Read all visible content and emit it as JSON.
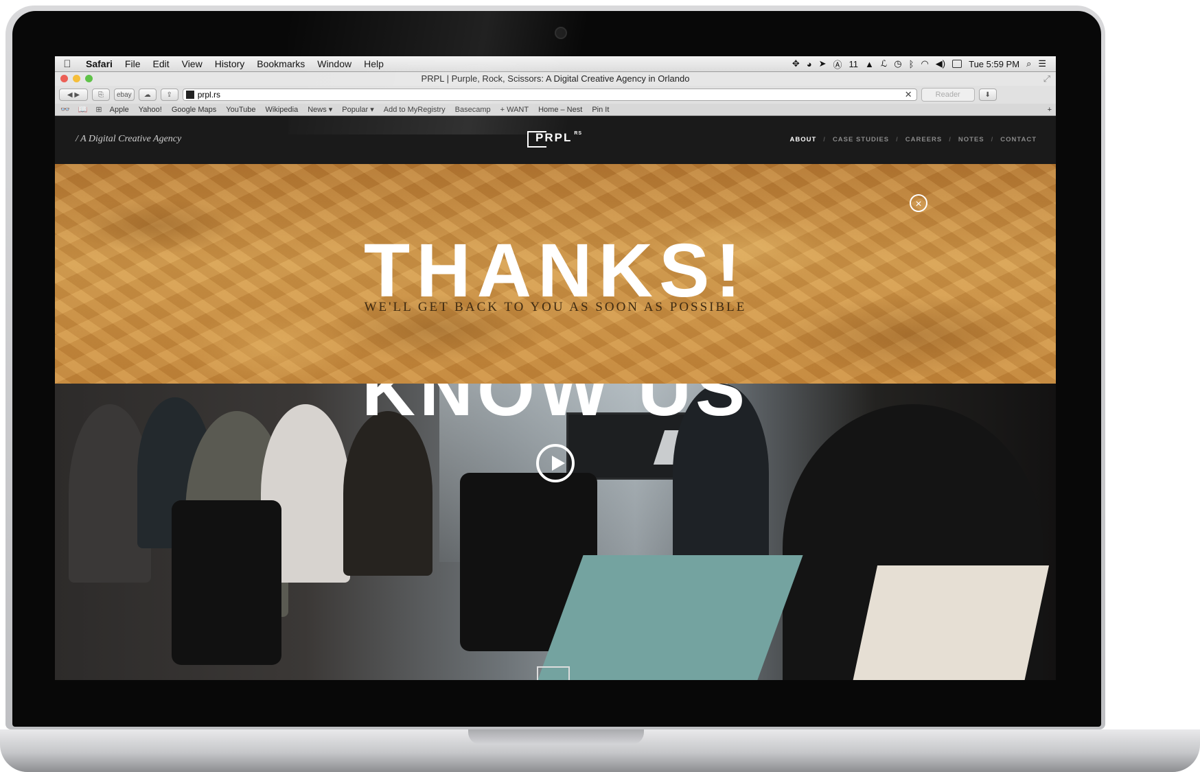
{
  "menubar": {
    "app": "Safari",
    "items": [
      "File",
      "Edit",
      "View",
      "History",
      "Bookmarks",
      "Window",
      "Help"
    ],
    "status_number": "11",
    "clock": "Tue 5:59 PM"
  },
  "browser": {
    "title": "PRPL | Purple, Rock, Scissors: A Digital Creative Agency in Orlando",
    "url": "prpl.rs",
    "reader_label": "Reader",
    "bookmarks": [
      "Apple",
      "Yahoo!",
      "Google Maps",
      "YouTube",
      "Wikipedia",
      "News ▾",
      "Popular ▾",
      "Add to MyRegistry",
      "Basecamp",
      "+ WANT",
      "Home – Nest",
      "Pin It"
    ],
    "toolbar_ebay": "ebay"
  },
  "site": {
    "tagline": "/ A Digital Creative Agency",
    "logo_text": "PRPL",
    "logo_sup": "RS",
    "nav": {
      "about": "ABOUT",
      "case_studies": "CASE STUDIES",
      "careers": "CAREERS",
      "notes": "NOTES",
      "contact": "CONTACT"
    },
    "thanks_title": "THANKS!",
    "thanks_subtitle": "WE'LL GET BACK TO YOU AS SOON AS POSSIBLE",
    "close_symbol": "×",
    "section_heading": "KNOW US"
  },
  "colors": {
    "accent_wood": "#c98a3c",
    "nav_bg": "#1a1a1a"
  }
}
